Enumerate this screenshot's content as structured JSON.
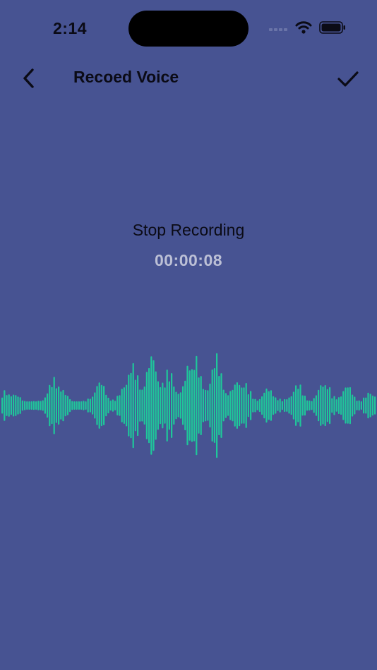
{
  "status": {
    "time": "2:14",
    "icons": [
      "signal-icon",
      "wifi-icon",
      "battery-icon"
    ]
  },
  "nav": {
    "title": "Recoed Voice",
    "back_icon": "chevron-left-icon",
    "done_icon": "checkmark-icon"
  },
  "recording": {
    "label": "Stop Recording",
    "timer": "00:00:08"
  },
  "colors": {
    "background": "#475392",
    "waveform": "#1fc79a",
    "timer_text": "#bcc0d6"
  }
}
